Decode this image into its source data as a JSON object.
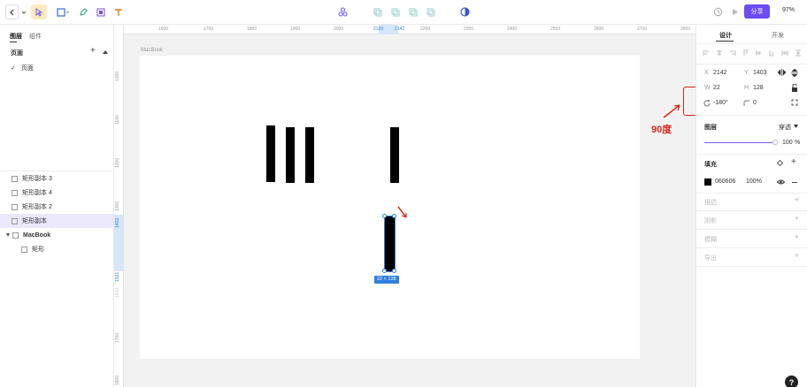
{
  "toolbar": {
    "share_label": "分享",
    "zoom": "97%"
  },
  "left_panel": {
    "tabs": [
      "图层",
      "组件"
    ],
    "pages_label": "页面",
    "current_page": "页面",
    "layers": [
      "矩形副本 3",
      "矩形副本 4",
      "矩形副本 2",
      "矩形副本",
      "MacBook",
      "矩形"
    ]
  },
  "canvas": {
    "frame_label": "MacBook",
    "ruler_top": [
      "1600",
      "1700",
      "1800",
      "1900",
      "2000",
      "2120",
      "2142",
      "2200",
      "2300",
      "2400",
      "2500",
      "2600",
      "2700",
      "2800"
    ],
    "ruler_left": [
      "1000",
      "1100",
      "1200",
      "1300",
      "1403",
      "1531",
      "1600",
      "1700",
      "1800"
    ],
    "size_badge": "22 × 128",
    "annotation": "90度"
  },
  "right_panel": {
    "tabs": [
      "设计",
      "开发"
    ],
    "x_label": "X",
    "x_value": "2142",
    "y_label": "Y",
    "y_value": "1403",
    "w_label": "W",
    "w_value": "22",
    "h_label": "H",
    "h_value": "128",
    "rotation": "-180°",
    "radius": "0",
    "layer_label": "图层",
    "blend_mode": "穿透",
    "opacity_value": "100",
    "opacity_unit": "%",
    "fill_label": "填充",
    "fill_hex": "060606",
    "fill_opacity": "100%",
    "fill_color": "#060606",
    "stroke_label": "描边",
    "shadow_label": "阴影",
    "blur_label": "模糊",
    "export_label": "导出"
  },
  "colors": {
    "accent": "#6c4cf5",
    "selection": "#2f7fe0",
    "annotation": "#d9261c"
  }
}
